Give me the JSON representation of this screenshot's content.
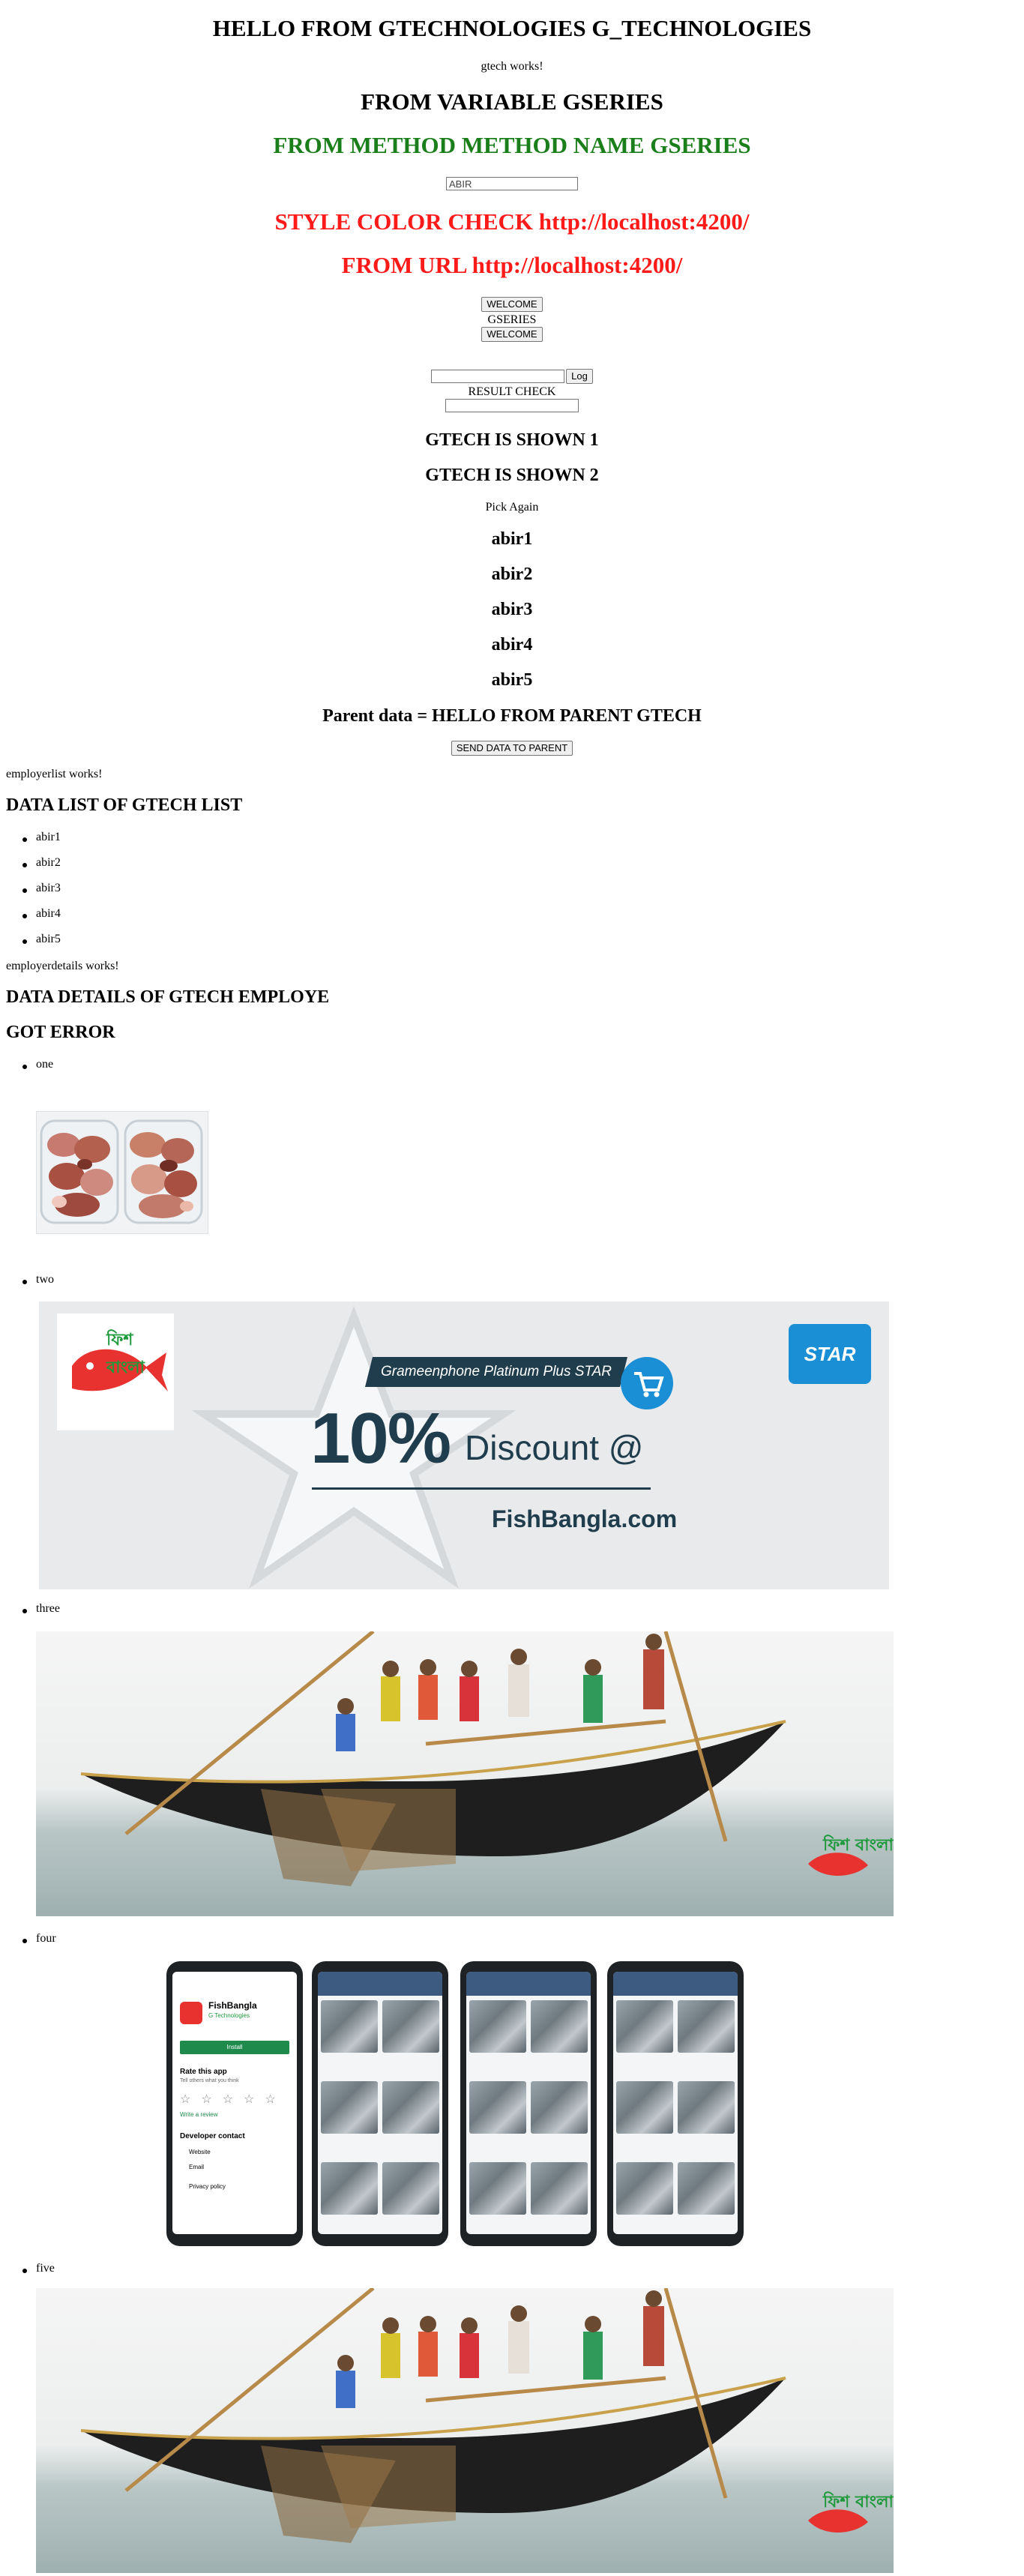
{
  "app": {
    "title": "HELLO FROM GTECHNOLOGIES G_TECHNOLOGIES",
    "works": "gtech works!",
    "variable_heading": "FROM VARIABLE GSERIES",
    "method_heading": "FROM METHOD METHOD NAME GSERIES",
    "name_input_value": "ABIR",
    "style_color_heading": "STYLE COLOR CHECK http://localhost:4200/",
    "url_heading": "FROM URL http://localhost:4200/",
    "welcome_button_1": "WELCOME",
    "gseries_label": "GSERIES",
    "welcome_button_2": "WELCOME",
    "log_input_value": "",
    "log_button": "Log",
    "result_check_label": "RESULT CHECK",
    "result_input_value": "",
    "shown_1": "GTECH IS SHOWN 1",
    "shown_2": "GTECH IS SHOWN 2",
    "pick_again": "Pick Again",
    "names": [
      "abir1",
      "abir2",
      "abir3",
      "abir4",
      "abir5"
    ],
    "parent_data": "Parent data = HELLO FROM PARENT GTECH",
    "send_button": "SEND DATA TO PARENT"
  },
  "employer_list": {
    "works": "employerlist works!",
    "heading": "DATA LIST OF GTECH LIST",
    "items": [
      "abir1",
      "abir2",
      "abir3",
      "abir4",
      "abir5"
    ]
  },
  "employer_details": {
    "works": "employerdetails works!",
    "heading": "DATA DETAILS OF GTECH EMPLOYE",
    "error_heading": "GOT ERROR",
    "items": [
      {
        "label": "one",
        "image": "fish-pieces-tray"
      },
      {
        "label": "two",
        "image": "grameenphone-discount-banner"
      },
      {
        "label": "three",
        "image": "fishermen-boat"
      },
      {
        "label": "four",
        "image": "fishbangla-app-screens"
      },
      {
        "label": "five",
        "image": "fishermen-boat"
      }
    ]
  },
  "banner": {
    "logo_text": "ফিশ বাংলা",
    "tagline": "Grameenphone Platinum Plus STAR",
    "discount": "10%",
    "discount_text": "Discount @",
    "site": "FishBangla.com",
    "star_badge": "STAR"
  },
  "phone_app": {
    "app_name": "FishBangla",
    "developer": "G Technologies",
    "install": "Install",
    "rate_title": "Rate this app",
    "rate_sub": "Tell others what you think",
    "write_review": "Write a review",
    "dev_contact": "Developer contact",
    "website": "Website",
    "email": "Email",
    "privacy": "Privacy policy"
  },
  "colors": {
    "green": "#1a7f1a",
    "red": "#ff1a1a",
    "banner_teal": "#1f3d4d",
    "banner_blue": "#1a8fd6",
    "logo_red": "#e8322f",
    "logo_green": "#1e9a3c"
  }
}
